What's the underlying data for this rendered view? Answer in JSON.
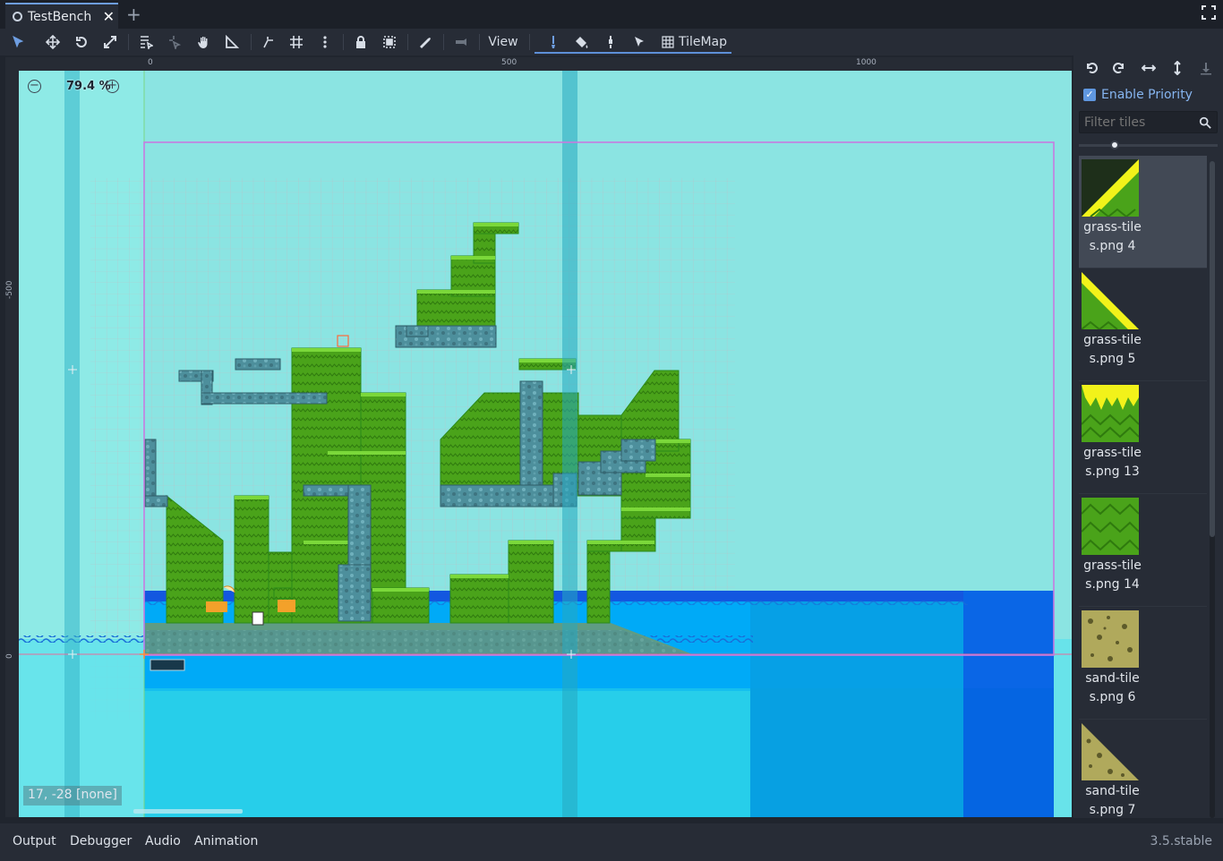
{
  "tab": {
    "title": "TestBench"
  },
  "toolbar": {
    "view_label": "View",
    "tilemap_label": "TileMap"
  },
  "ruler": {
    "top_labels": [
      "0",
      "500",
      "1000"
    ],
    "left_labels": [
      "-500",
      "0"
    ]
  },
  "viewport": {
    "zoom": "79.4 %",
    "coords": "17, -28 [none]"
  },
  "dock": {
    "enable_priority_label": "Enable Priority",
    "enable_priority_checked": true,
    "filter_placeholder": "Filter tiles",
    "tiles": [
      {
        "label": "grass-tiles.png 4",
        "line1": "grass-tile",
        "line2": "s.png 4",
        "kind": "grass-slope-yellow",
        "selected": true
      },
      {
        "label": "grass-tiles.png 5",
        "line1": "grass-tile",
        "line2": "s.png 5",
        "kind": "grass-slope"
      },
      {
        "label": "grass-tiles.png 13",
        "line1": "grass-tile",
        "line2": "s.png 13",
        "kind": "grass-top"
      },
      {
        "label": "grass-tiles.png 14",
        "line1": "grass-tile",
        "line2": "s.png 14",
        "kind": "grass-fill"
      },
      {
        "label": "sand-tiles.png 6",
        "line1": "sand-tile",
        "line2": "s.png 6",
        "kind": "sand-fill"
      },
      {
        "label": "sand-tiles.png 7",
        "line1": "sand-tile",
        "line2": "s.png 7",
        "kind": "sand-slope"
      }
    ]
  },
  "bottom_panel": {
    "tabs": [
      "Output",
      "Debugger",
      "Audio",
      "Animation"
    ],
    "version": "3.5.stable"
  },
  "colors": {
    "accent": "#6e9ee2",
    "sky": "#8be4e2",
    "grass": "#4aa31a",
    "water": "#02a8f8",
    "stone": "#4d8f9c",
    "camera_frame": "#c77be0"
  }
}
